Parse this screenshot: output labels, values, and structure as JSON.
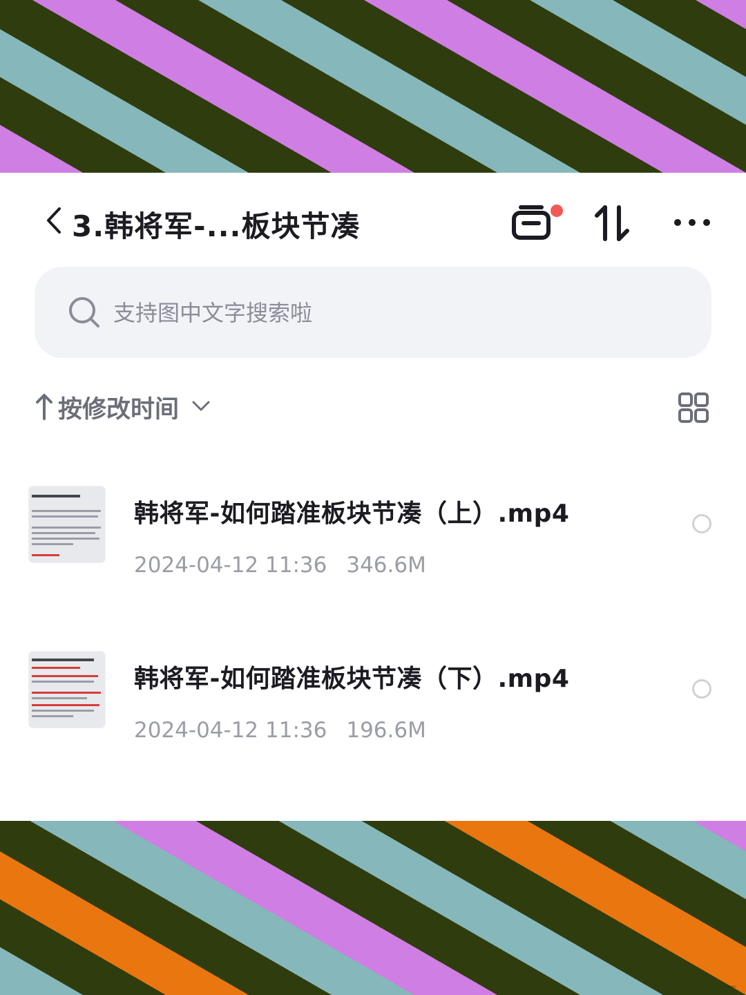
{
  "header": {
    "title": "3.韩将军-...板块节凑"
  },
  "search": {
    "placeholder": "支持图中文字搜索啦"
  },
  "sort": {
    "label": "按修改时间"
  },
  "files": [
    {
      "name": "韩将军-如何踏准板块节凑（上）.mp4",
      "date": "2024-04-12 11:36",
      "size": "346.6M"
    },
    {
      "name": "韩将军-如何踏准板块节凑（下）.mp4",
      "date": "2024-04-12 11:36",
      "size": "196.6M"
    }
  ],
  "colors": {
    "accent_dot": "#f35a56",
    "stripe_purple": "#cf7ee3",
    "stripe_olive": "#2f3d0e",
    "stripe_teal": "#86b7ba",
    "stripe_orange": "#e9760f"
  }
}
